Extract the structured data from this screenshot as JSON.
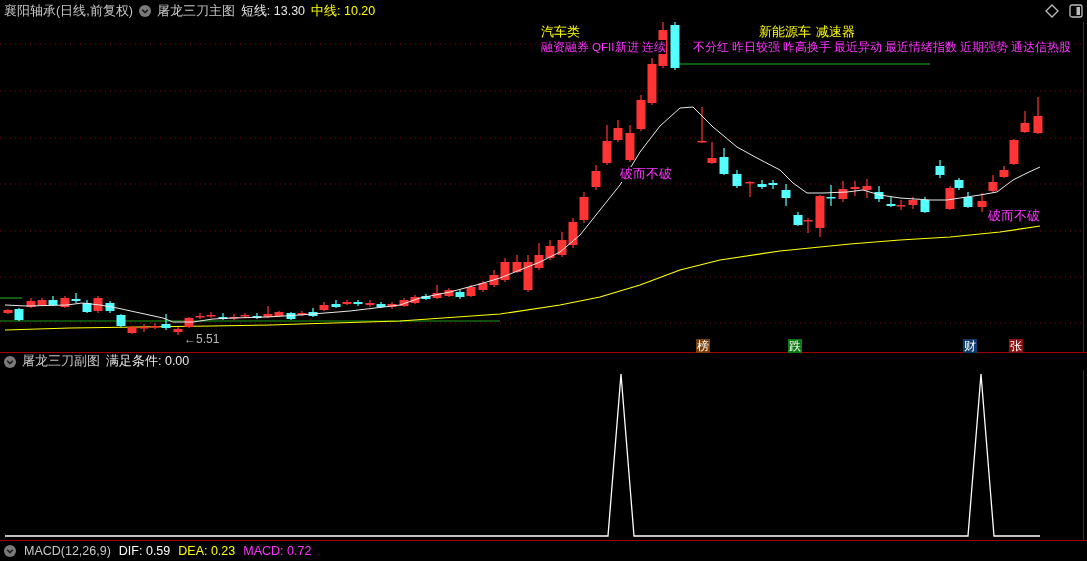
{
  "main_chart": {
    "symbol": "襄阳轴承(日线,前复权)",
    "indicator": "屠龙三刀主图",
    "readings": [
      {
        "text": "短线: 13.30",
        "color": "#e8e8e8"
      },
      {
        "text": "中线: 10.20",
        "color": "#ffff00"
      }
    ],
    "concept_tags": [
      "汽车类",
      "新能源车",
      "减速器"
    ],
    "feature_tags": [
      "融资融券",
      "QFII新进",
      "连续",
      "不分红",
      "昨日较强",
      "昨高换手",
      "最近异动",
      "最近情绪指数",
      "近期强势",
      "通达信热股"
    ],
    "signal_labels": [
      "破而不破",
      "破而不破"
    ],
    "low_label": "←5.51",
    "event_markers": [
      {
        "text": "榜",
        "color": "#7a3e0c"
      },
      {
        "text": "跌",
        "color": "#0b7a12"
      },
      {
        "text": "财",
        "color": "#0d3d6e"
      },
      {
        "text": "张",
        "color": "#8c1010"
      }
    ]
  },
  "sub_chart": {
    "title": "屠龙三刀副图",
    "reading": "满足条件: 0.00"
  },
  "macd_bar": {
    "title": "MACD(12,26,9)",
    "readings": [
      {
        "text": "DIF: 0.59",
        "color": "#ffffff"
      },
      {
        "text": "DEA: 0.23",
        "color": "#ffff00"
      },
      {
        "text": "MACD: 0.72",
        "color": "#ff33ff"
      }
    ]
  }
}
